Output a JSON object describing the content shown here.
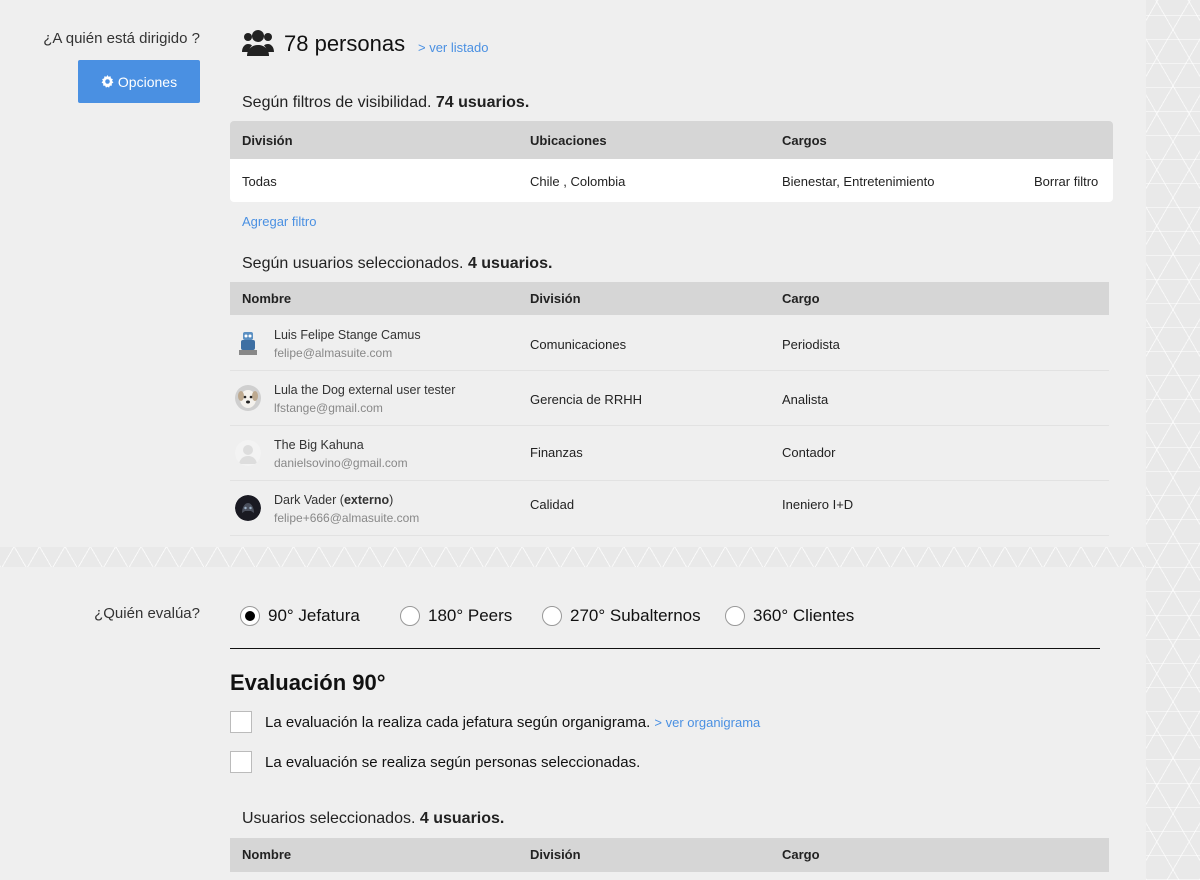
{
  "audience": {
    "label": "¿A quién está dirigido ?",
    "options_button": "Opciones",
    "people_count": "78 personas",
    "ver_listado": "> ver listado"
  },
  "visibility": {
    "heading_prefix": "Según filtros de visibilidad.",
    "heading_count": "74 usuarios.",
    "columns": [
      "División",
      "Ubicaciones",
      "Cargos"
    ],
    "row": {
      "division": "Todas",
      "ubicaciones": "Chile , Colombia",
      "cargos": "Bienestar, Entretenimiento",
      "action": "Borrar filtro"
    },
    "add_filter": "Agregar filtro"
  },
  "selected": {
    "heading_prefix": "Según usuarios seleccionados.",
    "heading_count": "4 usuarios.",
    "columns": [
      "Nombre",
      "División",
      "Cargo"
    ],
    "users": [
      {
        "name": "Luis Felipe Stange Camus",
        "email": "felipe@almasuite.com",
        "division": "Comunicaciones",
        "cargo": "Periodista",
        "avatar": "robot-avatar"
      },
      {
        "name": "Lula the Dog external user tester",
        "email": "lfstange@gmail.com",
        "division": "Gerencia de RRHH",
        "cargo": "Analista",
        "avatar": "dog-avatar"
      },
      {
        "name": "The Big Kahuna",
        "email": "danielsovino@gmail.com",
        "division": "Finanzas",
        "cargo": "Contador",
        "avatar": "default-avatar"
      },
      {
        "name": "Dark Vader (",
        "name_bold": "externo",
        "name_suffix": ")",
        "email": "felipe+666@almasuite.com",
        "division": "Calidad",
        "cargo": "Ineniero I+D",
        "avatar": "vader-avatar"
      }
    ]
  },
  "evaluator": {
    "label": "¿Quién evalúa?",
    "options": [
      "90° Jefatura",
      "180° Peers",
      "270° Subalternos",
      "360° Clientes"
    ],
    "selected_index": 0,
    "section_title": "Evaluación 90°",
    "checkbox1": "La evaluación la realiza cada jefatura según organigrama.",
    "checkbox1_link": "> ver organigrama",
    "checkbox2": "La evaluación se realiza según personas seleccionadas.",
    "users_heading_prefix": "Usuarios seleccionados.",
    "users_heading_count": "4 usuarios.",
    "columns": [
      "Nombre",
      "División",
      "Cargo"
    ]
  },
  "colors": {
    "accent": "#4a90e2",
    "header_bg": "#d6d6d6",
    "page_bg": "#efefef"
  }
}
